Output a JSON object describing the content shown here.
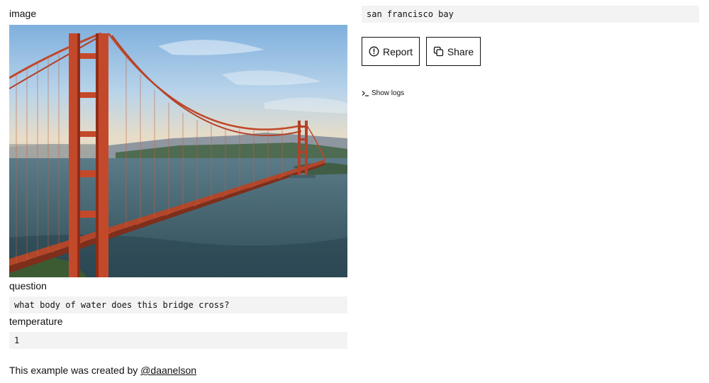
{
  "inputs": {
    "image_label": "image",
    "question_label": "question",
    "question_value": "what body of water does this bridge cross?",
    "temperature_label": "temperature",
    "temperature_value": "1"
  },
  "output": {
    "value": "san francisco bay"
  },
  "actions": {
    "report_label": "Report",
    "share_label": "Share",
    "show_logs_label": "Show logs"
  },
  "credit": {
    "prefix": "This example was created by ",
    "author": "@daanelson"
  }
}
